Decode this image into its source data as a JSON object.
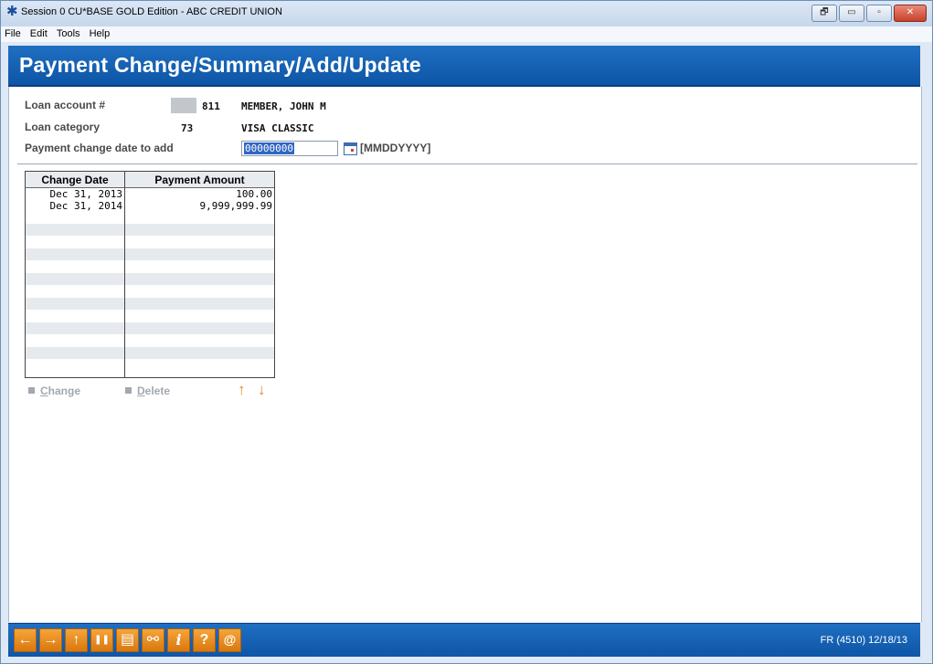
{
  "window": {
    "title": "Session 0 CU*BASE GOLD Edition - ABC CREDIT UNION",
    "controls": {
      "restore": "🗗",
      "minimize": "▭",
      "maximize": "▫",
      "close": "✕"
    }
  },
  "menu": [
    "File",
    "Edit",
    "Tools",
    "Help"
  ],
  "page": {
    "title": "Payment Change/Summary/Add/Update"
  },
  "form": {
    "loan_account_label": "Loan account #",
    "loan_account_suffix": "811",
    "member_name": "MEMBER, JOHN M",
    "loan_category_label": "Loan category",
    "loan_category_code": "73",
    "loan_category_name": "VISA CLASSIC",
    "payment_date_label": "Payment change date to add",
    "payment_date_value": "00000000",
    "date_format_hint": "[MMDDYYYY]"
  },
  "table": {
    "columns": [
      "Change Date",
      "Payment Amount"
    ],
    "rows": [
      {
        "date": "Dec 31, 2013",
        "amount": "100.00"
      },
      {
        "date": "Dec 31, 2014",
        "amount": "9,999,999.99"
      }
    ]
  },
  "actions": {
    "change_first": "C",
    "change_rest": "hange",
    "delete_first": "D",
    "delete_rest": "elete",
    "up_arrow": "↑",
    "down_arrow": "↓"
  },
  "footer": {
    "buttons": [
      {
        "name": "back-icon",
        "glyph": "←"
      },
      {
        "name": "forward-icon",
        "glyph": "→"
      },
      {
        "name": "up-icon",
        "glyph": "↑"
      },
      {
        "name": "pause-icon",
        "glyph": "❚❚"
      },
      {
        "name": "print-icon",
        "glyph": "▤"
      },
      {
        "name": "link-icon",
        "glyph": "⚯"
      },
      {
        "name": "info-icon",
        "glyph": "i"
      },
      {
        "name": "help-icon",
        "glyph": "?"
      },
      {
        "name": "at-icon",
        "glyph": "@"
      }
    ],
    "status": "FR (4510) 12/18/13"
  },
  "colors": {
    "header_blue": "#1565b8",
    "button_orange": "#e8901f",
    "selection_blue": "#2f66c4"
  }
}
